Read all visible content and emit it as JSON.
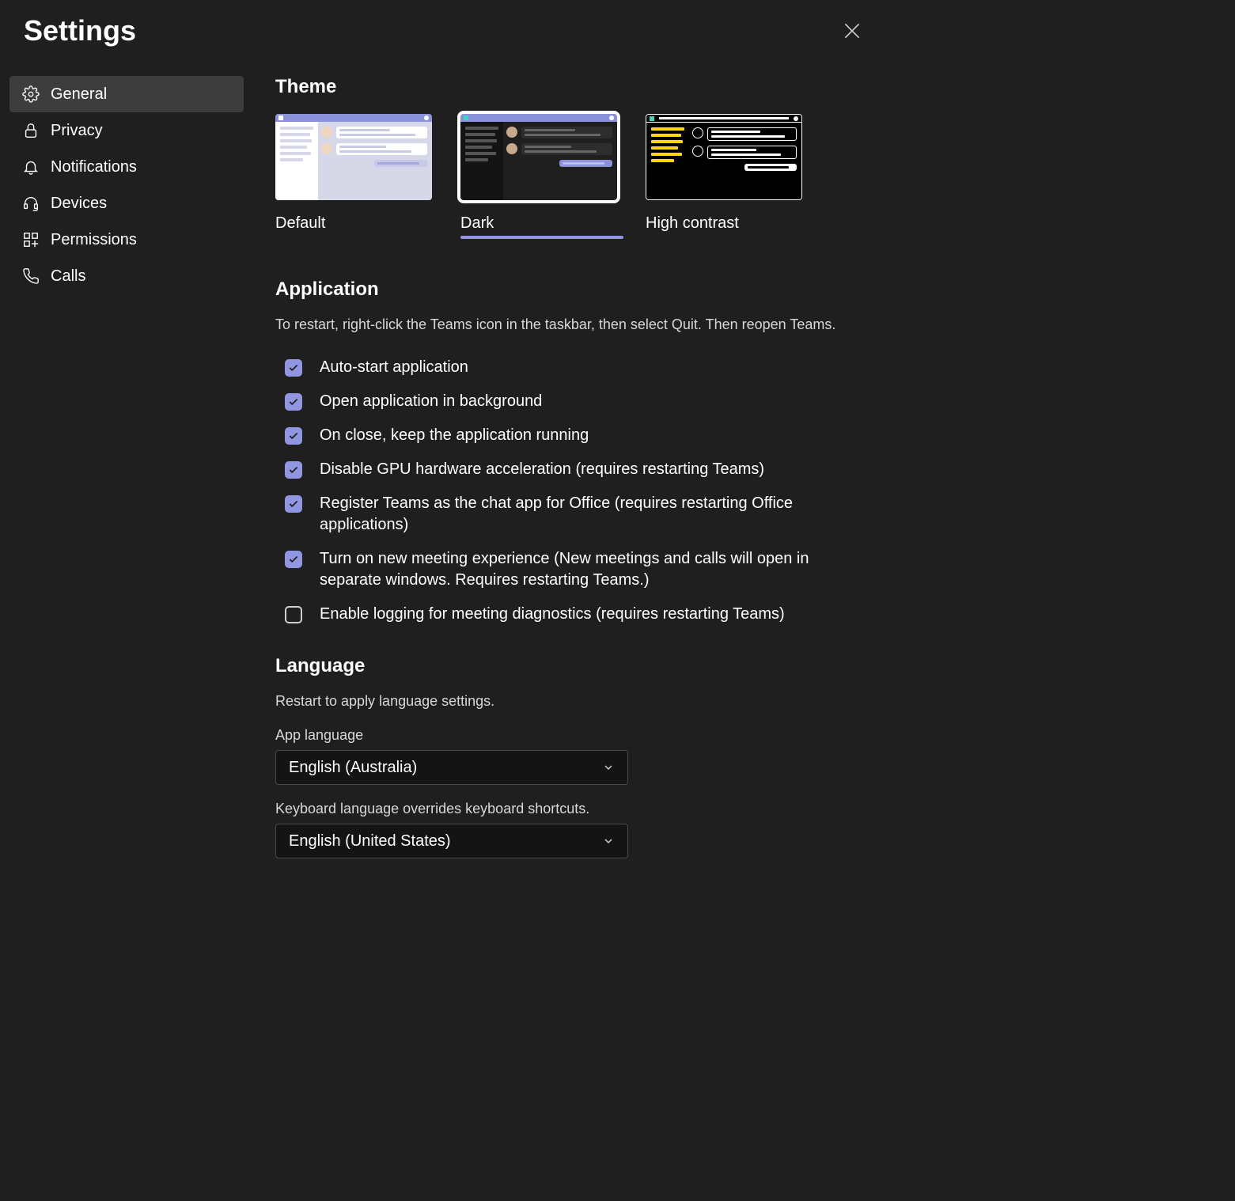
{
  "header": {
    "title": "Settings"
  },
  "sidebar": {
    "items": [
      {
        "label": "General"
      },
      {
        "label": "Privacy"
      },
      {
        "label": "Notifications"
      },
      {
        "label": "Devices"
      },
      {
        "label": "Permissions"
      },
      {
        "label": "Calls"
      }
    ]
  },
  "main": {
    "theme": {
      "heading": "Theme",
      "options": [
        {
          "label": "Default"
        },
        {
          "label": "Dark"
        },
        {
          "label": "High contrast"
        }
      ],
      "selected": "Dark"
    },
    "application": {
      "heading": "Application",
      "note": "To restart, right-click the Teams icon in the taskbar, then select Quit. Then reopen Teams.",
      "checks": [
        {
          "checked": true,
          "label": "Auto-start application"
        },
        {
          "checked": true,
          "label": "Open application in background"
        },
        {
          "checked": true,
          "label": "On close, keep the application running"
        },
        {
          "checked": true,
          "label": "Disable GPU hardware acceleration (requires restarting Teams)"
        },
        {
          "checked": true,
          "label": "Register Teams as the chat app for Office (requires restarting Office applications)"
        },
        {
          "checked": true,
          "label": "Turn on new meeting experience (New meetings and calls will open in separate windows. Requires restarting Teams.)"
        },
        {
          "checked": false,
          "label": "Enable logging for meeting diagnostics (requires restarting Teams)"
        }
      ]
    },
    "language": {
      "heading": "Language",
      "note": "Restart to apply language settings.",
      "app_language_label": "App language",
      "app_language_value": "English (Australia)",
      "keyboard_note": "Keyboard language overrides keyboard shortcuts.",
      "keyboard_language_value": "English (United States)"
    }
  }
}
